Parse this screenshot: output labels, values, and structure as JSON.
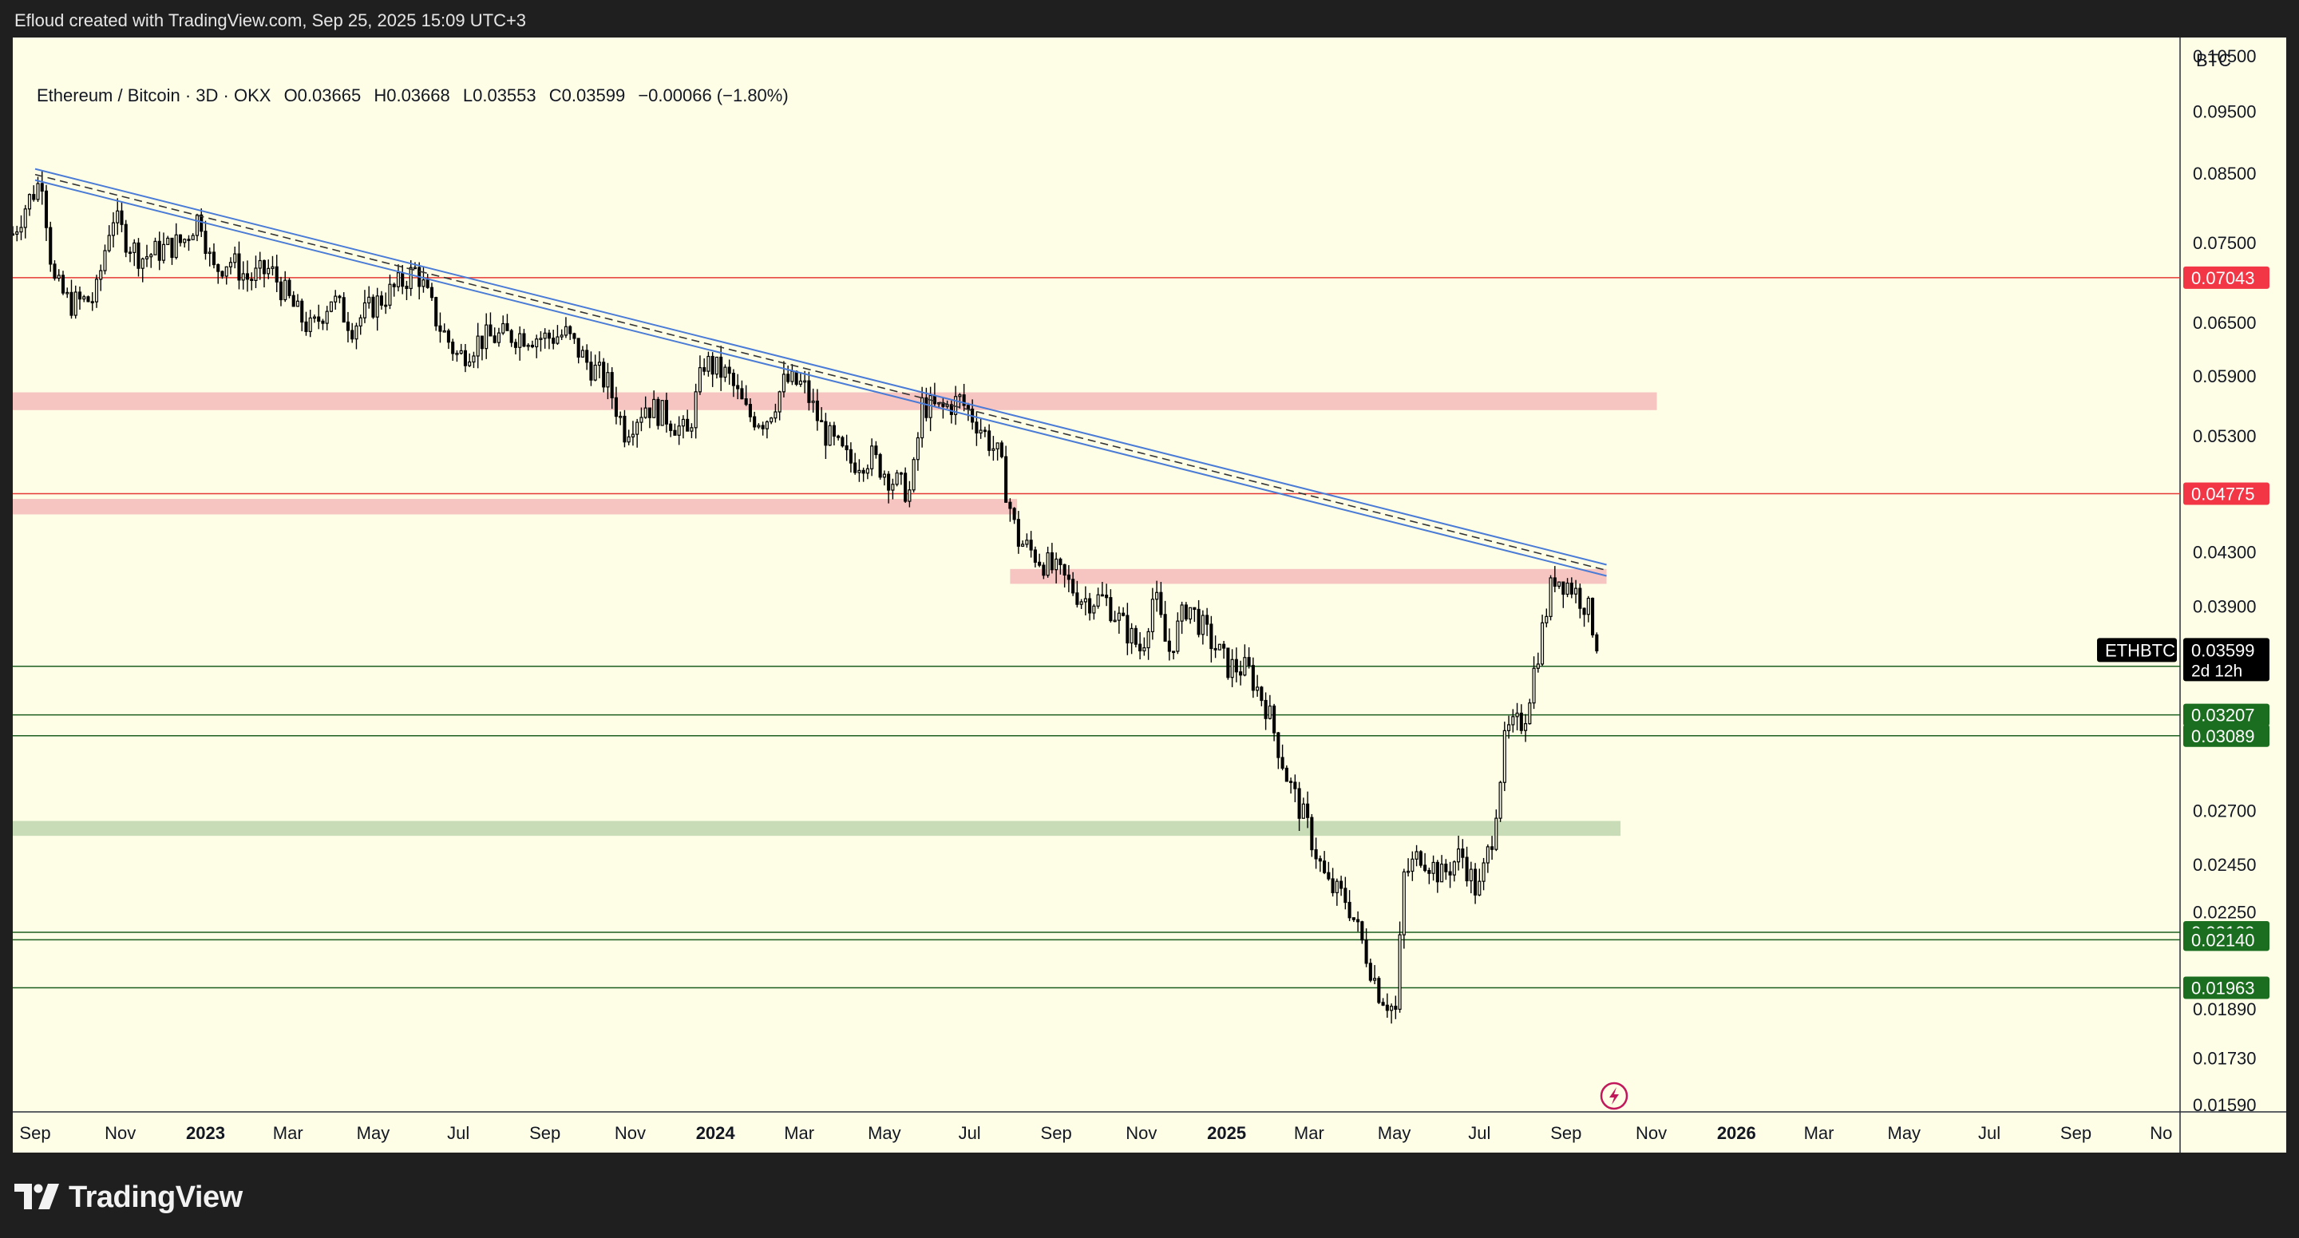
{
  "header": {
    "text": "Efloud created with TradingView.com, Sep 25, 2025 15:09 UTC+3"
  },
  "legend": {
    "symbol": "Ethereum / Bitcoin · 3D · OKX",
    "open": "O0.03665",
    "high": "H0.03668",
    "low": "L0.03553",
    "close": "C0.03599",
    "change": "−0.00066 (−1.80%)"
  },
  "footer": {
    "brand": "TradingView",
    "logo_icon": "tradingview-logo-icon"
  },
  "colors": {
    "background": "#fefee6",
    "candle": "#000000",
    "trendline": "#4a7bd6",
    "red_level": "#e53935",
    "red_zone": "#f6c5c1",
    "green_level": "#1b5e20",
    "green_zone": "#c8dcb8",
    "price_tag": "#000000",
    "red_tag": "#f23645",
    "green_tag": "#1b6e1f"
  },
  "chart_data": {
    "type": "line",
    "symbol": "ETHBTC",
    "currency": "BTC",
    "timeframe": "3D",
    "scale": "log",
    "ylim": [
      0.0157,
      0.1085
    ],
    "xlim": [
      "2022-08-16",
      "2026-11-14"
    ],
    "y_ticks": [
      "0.10500",
      "0.09500",
      "0.08500",
      "0.07500",
      "0.06500",
      "0.05900",
      "0.05300",
      "0.04300",
      "0.03900",
      "0.02700",
      "0.02450",
      "0.02250",
      "0.01890",
      "0.01730",
      "0.01590"
    ],
    "x_ticks": [
      {
        "label": "Sep",
        "date": "2022-09-01"
      },
      {
        "label": "Nov",
        "date": "2022-11-01"
      },
      {
        "label": "2023",
        "date": "2023-01-01",
        "bold": true
      },
      {
        "label": "Mar",
        "date": "2023-03-01"
      },
      {
        "label": "May",
        "date": "2023-05-01"
      },
      {
        "label": "Jul",
        "date": "2023-07-01"
      },
      {
        "label": "Sep",
        "date": "2023-09-01"
      },
      {
        "label": "Nov",
        "date": "2023-11-01"
      },
      {
        "label": "2024",
        "date": "2024-01-01",
        "bold": true
      },
      {
        "label": "Mar",
        "date": "2024-03-01"
      },
      {
        "label": "May",
        "date": "2024-05-01"
      },
      {
        "label": "Jul",
        "date": "2024-07-01"
      },
      {
        "label": "Sep",
        "date": "2024-09-01"
      },
      {
        "label": "Nov",
        "date": "2024-11-01"
      },
      {
        "label": "2025",
        "date": "2025-01-01",
        "bold": true
      },
      {
        "label": "Mar",
        "date": "2025-03-01"
      },
      {
        "label": "May",
        "date": "2025-05-01"
      },
      {
        "label": "Jul",
        "date": "2025-07-01"
      },
      {
        "label": "Sep",
        "date": "2025-09-01"
      },
      {
        "label": "Nov",
        "date": "2025-11-01"
      },
      {
        "label": "2026",
        "date": "2026-01-01",
        "bold": true
      },
      {
        "label": "Mar",
        "date": "2026-03-01"
      },
      {
        "label": "May",
        "date": "2026-05-01"
      },
      {
        "label": "Jul",
        "date": "2026-07-01"
      },
      {
        "label": "Sep",
        "date": "2026-09-01"
      },
      {
        "label": "No",
        "date": "2026-11-01"
      }
    ],
    "price_path": [
      [
        "2022-08-16",
        0.0762
      ],
      [
        "2022-08-26",
        0.0805
      ],
      [
        "2022-09-06",
        0.0842
      ],
      [
        "2022-09-14",
        0.07
      ],
      [
        "2022-09-26",
        0.0672
      ],
      [
        "2022-10-14",
        0.0678
      ],
      [
        "2022-10-26",
        0.079
      ],
      [
        "2022-11-06",
        0.0752
      ],
      [
        "2022-11-16",
        0.073
      ],
      [
        "2022-12-16",
        0.0752
      ],
      [
        "2022-12-28",
        0.079
      ],
      [
        "2023-01-06",
        0.0712
      ],
      [
        "2023-01-18",
        0.0728
      ],
      [
        "2023-02-01",
        0.0702
      ],
      [
        "2023-02-16",
        0.0715
      ],
      [
        "2023-03-08",
        0.066
      ],
      [
        "2023-03-18",
        0.064
      ],
      [
        "2023-04-01",
        0.068
      ],
      [
        "2023-04-16",
        0.0646
      ],
      [
        "2023-05-01",
        0.067
      ],
      [
        "2023-05-16",
        0.069
      ],
      [
        "2023-06-01",
        0.0715
      ],
      [
        "2023-06-16",
        0.065
      ],
      [
        "2023-07-01",
        0.061
      ],
      [
        "2023-07-16",
        0.063
      ],
      [
        "2023-08-01",
        0.0634
      ],
      [
        "2023-08-16",
        0.0636
      ],
      [
        "2023-09-01",
        0.0632
      ],
      [
        "2023-09-16",
        0.0636
      ],
      [
        "2023-10-01",
        0.0605
      ],
      [
        "2023-10-16",
        0.0582
      ],
      [
        "2023-10-28",
        0.0535
      ],
      [
        "2023-11-12",
        0.056
      ],
      [
        "2023-11-28",
        0.0548
      ],
      [
        "2023-12-12",
        0.053
      ],
      [
        "2023-12-24",
        0.0605
      ],
      [
        "2024-01-10",
        0.059
      ],
      [
        "2024-01-24",
        0.055
      ],
      [
        "2024-02-06",
        0.0545
      ],
      [
        "2024-02-20",
        0.0585
      ],
      [
        "2024-03-04",
        0.058
      ],
      [
        "2024-03-18",
        0.0535
      ],
      [
        "2024-04-06",
        0.0505
      ],
      [
        "2024-04-22",
        0.051
      ],
      [
        "2024-05-06",
        0.049
      ],
      [
        "2024-05-20",
        0.0478
      ],
      [
        "2024-05-28",
        0.056
      ],
      [
        "2024-06-10",
        0.0555
      ],
      [
        "2024-06-24",
        0.0565
      ],
      [
        "2024-07-08",
        0.054
      ],
      [
        "2024-07-22",
        0.051
      ],
      [
        "2024-08-04",
        0.044
      ],
      [
        "2024-08-20",
        0.0425
      ],
      [
        "2024-09-06",
        0.041
      ],
      [
        "2024-09-20",
        0.0395
      ],
      [
        "2024-10-06",
        0.0395
      ],
      [
        "2024-10-20",
        0.0375
      ],
      [
        "2024-11-01",
        0.036
      ],
      [
        "2024-11-10",
        0.04
      ],
      [
        "2024-11-20",
        0.0358
      ],
      [
        "2024-12-04",
        0.0392
      ],
      [
        "2024-12-18",
        0.037
      ],
      [
        "2025-01-02",
        0.035
      ],
      [
        "2025-01-16",
        0.0348
      ],
      [
        "2025-01-30",
        0.0325
      ],
      [
        "2025-02-14",
        0.0285
      ],
      [
        "2025-02-28",
        0.0262
      ],
      [
        "2025-03-14",
        0.0236
      ],
      [
        "2025-03-28",
        0.023
      ],
      [
        "2025-04-10",
        0.021
      ],
      [
        "2025-04-20",
        0.0195
      ],
      [
        "2025-05-02",
        0.0188
      ],
      [
        "2025-05-08",
        0.024
      ],
      [
        "2025-05-20",
        0.025
      ],
      [
        "2025-06-04",
        0.024
      ],
      [
        "2025-06-18",
        0.025
      ],
      [
        "2025-06-30",
        0.0232
      ],
      [
        "2025-07-10",
        0.0258
      ],
      [
        "2025-07-20",
        0.031
      ],
      [
        "2025-08-02",
        0.0318
      ],
      [
        "2025-08-12",
        0.036
      ],
      [
        "2025-08-23",
        0.0412
      ],
      [
        "2025-09-04",
        0.0405
      ],
      [
        "2025-09-16",
        0.039
      ],
      [
        "2025-09-25",
        0.03599
      ]
    ],
    "trendlines": [
      {
        "from": [
          "2022-09-01",
          0.0848
        ],
        "to": [
          "2025-09-30",
          0.0416
        ]
      }
    ],
    "levels_red": [
      0.07043,
      0.04775
    ],
    "levels_green": [
      0.035,
      0.03207,
      0.03089,
      0.02169,
      0.0214,
      0.01963
    ],
    "zones_red": [
      {
        "from": "2022-08-16",
        "to": "2025-11-05",
        "low": 0.0555,
        "high": 0.0573
      },
      {
        "from": "2022-08-16",
        "to": "2024-08-04",
        "low": 0.046,
        "high": 0.0473
      },
      {
        "from": "2024-07-30",
        "to": "2025-09-30",
        "low": 0.0406,
        "high": 0.0417
      }
    ],
    "zones_green": [
      {
        "from": "2022-08-16",
        "to": "2025-10-10",
        "low": 0.0258,
        "high": 0.0265
      }
    ],
    "current_price": {
      "symbol": "ETHBTC",
      "value": "0.03599",
      "countdown": "2d 12h"
    },
    "axis_tags_red": [
      "0.07043",
      "0.04775"
    ],
    "axis_tags_green": [
      "0.03500",
      "0.03207",
      "0.03089",
      "0.02169",
      "0.02140",
      "0.01963"
    ]
  }
}
